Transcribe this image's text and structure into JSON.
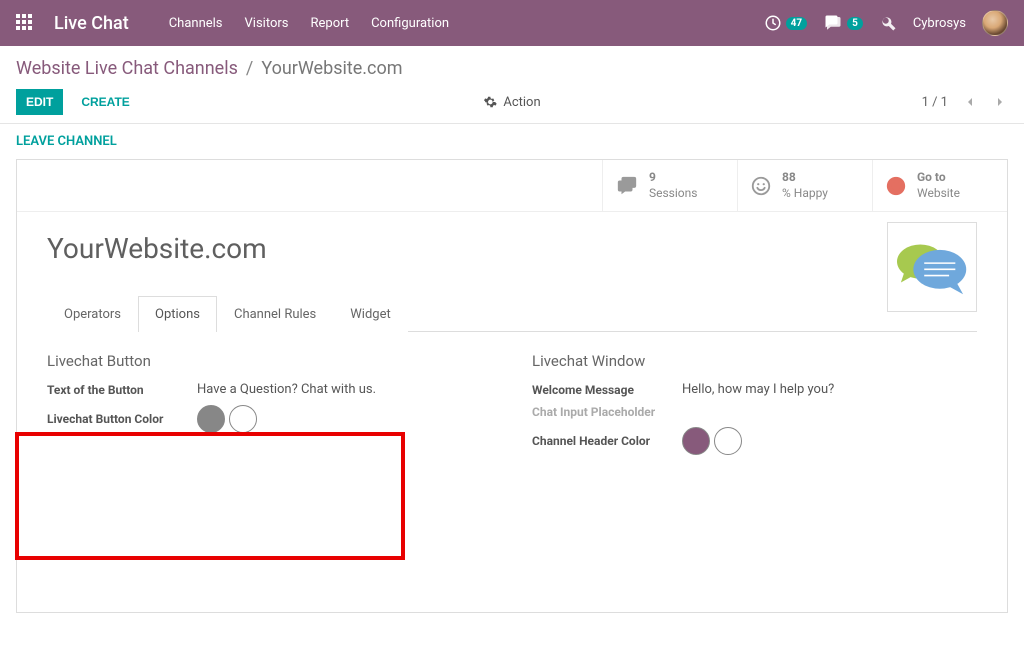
{
  "topnav": {
    "brand": "Live Chat",
    "links": [
      "Channels",
      "Visitors",
      "Report",
      "Configuration"
    ],
    "timer_badge": "47",
    "msg_badge": "5",
    "username": "Cybrosys"
  },
  "breadcrumb": {
    "root": "Website Live Chat Channels",
    "current": "YourWebsite.com"
  },
  "buttons": {
    "edit": "EDIT",
    "create": "CREATE",
    "action": "Action",
    "leave": "LEAVE CHANNEL"
  },
  "pager": "1 / 1",
  "stats": {
    "sessions_count": "9",
    "sessions_label": "Sessions",
    "happy_count": "88",
    "happy_label": "% Happy",
    "website_top": "Go to",
    "website_bottom": "Website"
  },
  "title": "YourWebsite.com",
  "tabs": [
    "Operators",
    "Options",
    "Channel Rules",
    "Widget"
  ],
  "left": {
    "heading": "Livechat Button",
    "text_label": "Text of the Button",
    "text_value": "Have a Question? Chat with us.",
    "color_label": "Livechat Button Color"
  },
  "right": {
    "heading": "Livechat Window",
    "welcome_label": "Welcome Message",
    "welcome_value": "Hello, how may I help you?",
    "placeholder_label": "Chat Input Placeholder",
    "header_color_label": "Channel Header Color"
  }
}
